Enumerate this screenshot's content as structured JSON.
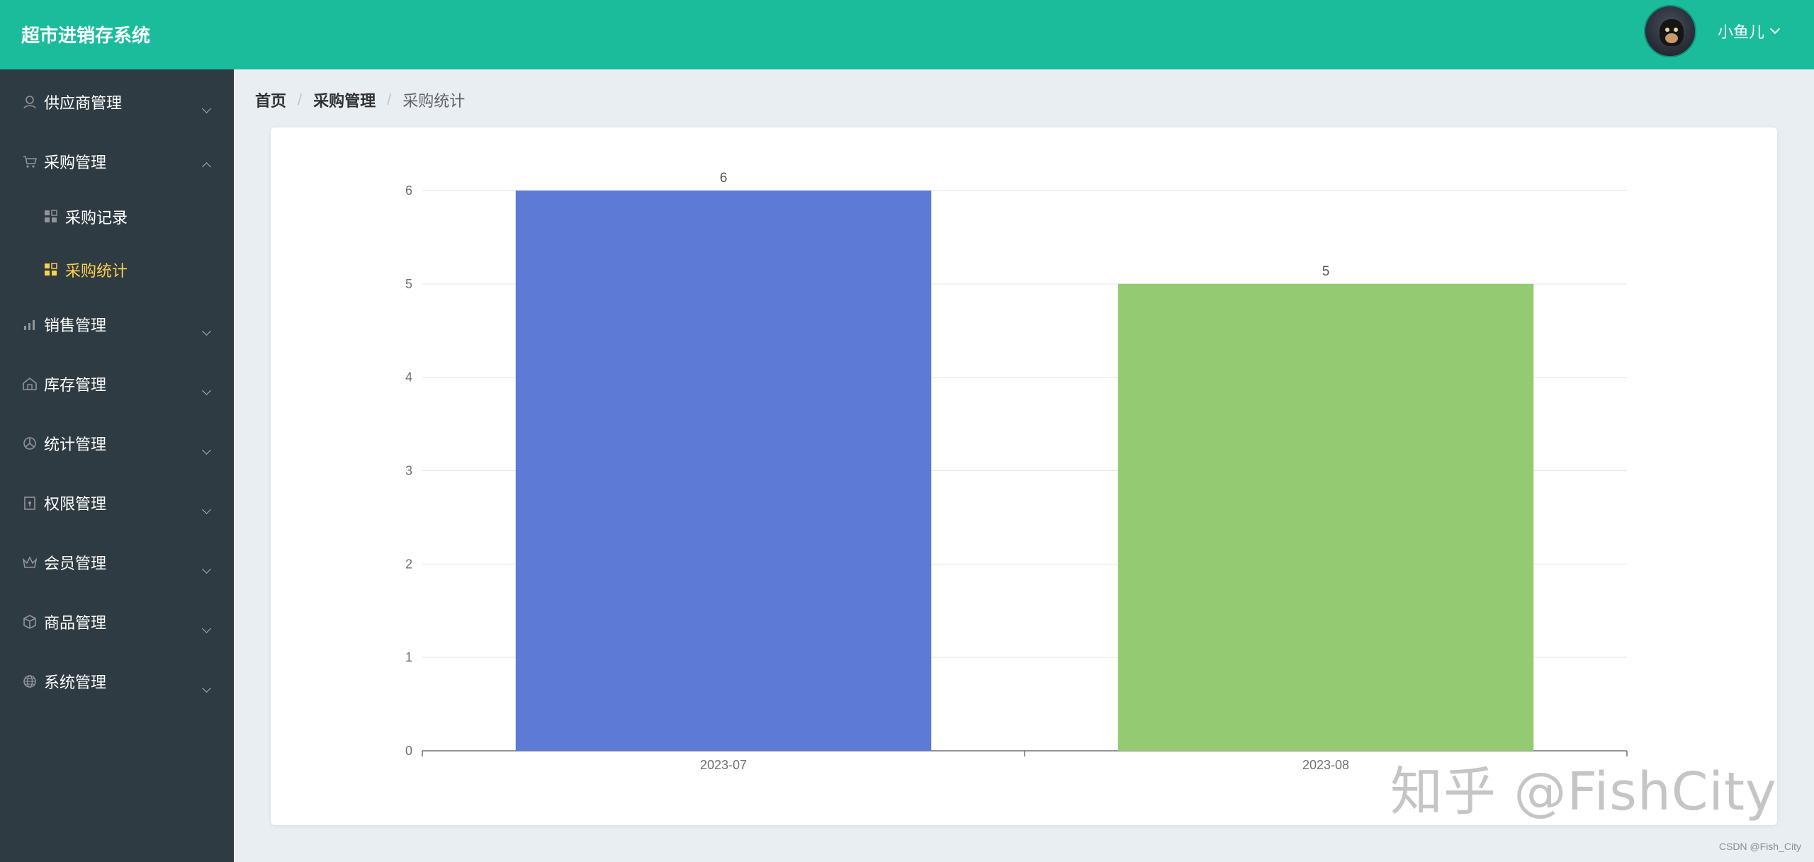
{
  "header": {
    "app_title": "超市进销存系统",
    "username": "小鱼儿"
  },
  "sidebar": {
    "items": [
      {
        "label": "供应商管理",
        "icon": "user-icon",
        "expanded": false
      },
      {
        "label": "采购管理",
        "icon": "cart-icon",
        "expanded": true,
        "children": [
          {
            "label": "采购记录",
            "icon": "grid-icon",
            "active": false
          },
          {
            "label": "采购统计",
            "icon": "grid-icon",
            "active": true
          }
        ]
      },
      {
        "label": "销售管理",
        "icon": "bar-chart-icon",
        "expanded": false
      },
      {
        "label": "库存管理",
        "icon": "house-icon",
        "expanded": false
      },
      {
        "label": "统计管理",
        "icon": "pie-icon",
        "expanded": false
      },
      {
        "label": "权限管理",
        "icon": "lock-icon",
        "expanded": false
      },
      {
        "label": "会员管理",
        "icon": "crown-icon",
        "expanded": false
      },
      {
        "label": "商品管理",
        "icon": "box-icon",
        "expanded": false
      },
      {
        "label": "系统管理",
        "icon": "globe-icon",
        "expanded": false
      }
    ]
  },
  "breadcrumb": [
    "首页",
    "采购管理",
    "采购统计"
  ],
  "chart_data": {
    "type": "bar",
    "categories": [
      "2023-07",
      "2023-08"
    ],
    "values": [
      6,
      5
    ],
    "colors": [
      "#5d7bd6",
      "#94cb72"
    ],
    "ylim": [
      0,
      6
    ],
    "yticks": [
      0,
      1,
      2,
      3,
      4,
      5,
      6
    ],
    "data_labels": true,
    "grid": true
  },
  "watermark": "知乎 @FishCity",
  "footer_credit": "CSDN @Fish_City",
  "colors": {
    "header": "#1abc9c",
    "sidebar": "#2e3b43",
    "active_menu": "#ffd04b"
  }
}
